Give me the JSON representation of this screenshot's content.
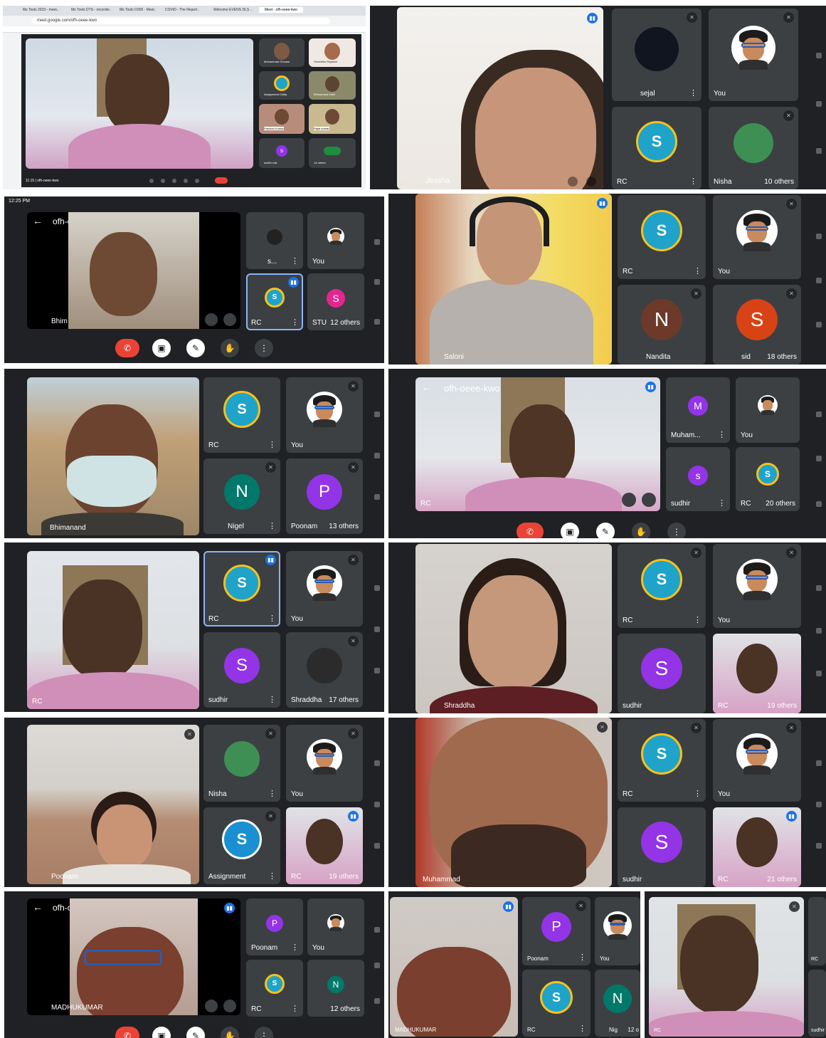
{
  "colors": {
    "meet_bg": "#202124",
    "tile_bg": "#3c4043",
    "end_call": "#ea4335",
    "speaking": "#1a73e8",
    "rc_blue": "#1fa3c9",
    "rc_yellow": "#f6c21c"
  },
  "shots": {
    "s1": {
      "browser_tabs": [
        "Ms Tools 2023 - meet..",
        "Ms Tools DTS - recorder..",
        "Ms Tools O365 - Meet..",
        "COVID - The Report..",
        "Welcome EVENS DLS ..",
        "Meet - ofh-oeee-kwo"
      ],
      "url": "meet.google.com/ofh-oeee-kwo",
      "bottom_left": "11:15 | ofh-oeee-kwo",
      "tiles": [
        {
          "name": "Muhammad Ghouse"
        },
        {
          "name": "Shraddha Rajalkar"
        },
        {
          "name": "Assignment Chitty"
        },
        {
          "name": "Bhimanand Kalle"
        },
        {
          "name": "Praveen Kumar"
        },
        {
          "name": "Rajat kumar"
        },
        {
          "name": "sudhir nair"
        },
        {
          "name": "14 others"
        }
      ]
    },
    "s2": {
      "main_name": "Jinisha",
      "tiles": [
        {
          "name": "sejal"
        },
        {
          "name": "You"
        },
        {
          "name": "RC"
        },
        {
          "name": "Nisha",
          "others": "10 others"
        }
      ]
    },
    "s3": {
      "status_time": "12:25 PM",
      "meeting": "ofh-oeee-kwo",
      "main_name": "Bhim",
      "tiles": [
        {
          "name": "s..."
        },
        {
          "name": "You"
        },
        {
          "name": "RC"
        },
        {
          "name": "STU",
          "others": "12 others"
        }
      ]
    },
    "s4": {
      "main_name": "Saloni",
      "tiles": [
        {
          "name": "RC"
        },
        {
          "name": "You"
        },
        {
          "name": "Nandita",
          "initial": "N"
        },
        {
          "name": "sid",
          "initial": "S",
          "others": "18 others"
        }
      ]
    },
    "s5": {
      "main_name": "Bhimanand",
      "tiles": [
        {
          "name": "RC"
        },
        {
          "name": "You"
        },
        {
          "name": "Nigel",
          "initial": "N"
        },
        {
          "name": "Poonam",
          "initial": "P",
          "others": "13 others"
        }
      ]
    },
    "s6": {
      "meeting": "ofh-oeee-kwo",
      "main_name": "RC",
      "tiles": [
        {
          "name": "Muham...",
          "initial": "M"
        },
        {
          "name": "You"
        },
        {
          "name": "sudhir",
          "initial": "s"
        },
        {
          "name": "RC",
          "others": "20 others"
        }
      ]
    },
    "s7": {
      "main_name": "RC",
      "tiles": [
        {
          "name": "RC"
        },
        {
          "name": "You"
        },
        {
          "name": "sudhir",
          "initial": "S"
        },
        {
          "name": "Shraddha",
          "others": "17 others"
        }
      ]
    },
    "s8": {
      "main_name": "Shraddha",
      "tiles": [
        {
          "name": "RC"
        },
        {
          "name": "You"
        },
        {
          "name": "sudhir",
          "initial": "S"
        },
        {
          "name": "RC",
          "others": "19 others"
        }
      ]
    },
    "s9": {
      "main_name": "Poonam",
      "tiles": [
        {
          "name": "Nisha"
        },
        {
          "name": "You"
        },
        {
          "name": "Assignment"
        },
        {
          "name": "RC",
          "others": "19 others"
        }
      ]
    },
    "s10": {
      "main_name": "Muhammad",
      "tiles": [
        {
          "name": "RC"
        },
        {
          "name": "You"
        },
        {
          "name": "sudhir",
          "initial": "S"
        },
        {
          "name": "RC",
          "others": "21 others"
        }
      ]
    },
    "s11": {
      "meeting": "ofh-oeee-kwo",
      "main_name": "MADHUKUMAR",
      "tiles": [
        {
          "name": "Poonam",
          "initial": "P"
        },
        {
          "name": "You"
        },
        {
          "name": "RC"
        },
        {
          "name": "N",
          "others": "12 others"
        }
      ]
    },
    "s12": {
      "main_name": "MADHUKUMAR",
      "tiles": [
        {
          "name": "Poonam",
          "initial": "P"
        },
        {
          "name": "You"
        },
        {
          "name": "RC"
        },
        {
          "name": "Nig",
          "others": "12 o"
        }
      ]
    },
    "s13": {
      "main_name": "RC",
      "tiles": [
        {
          "name": "RC"
        },
        {
          "name": "sudhir"
        }
      ]
    }
  }
}
